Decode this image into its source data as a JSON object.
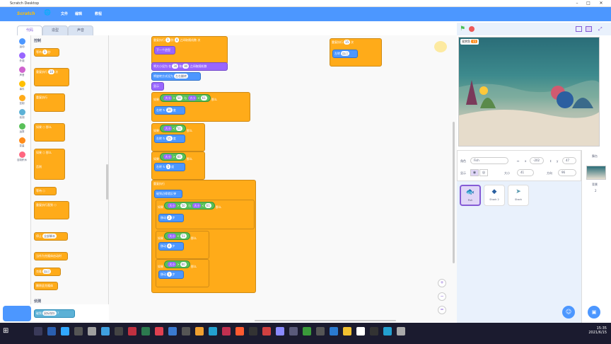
{
  "window": {
    "title": "Scratch Desktop"
  },
  "menubar": {
    "logo": "Scratch",
    "file": "文件",
    "edit": "编辑",
    "tutorials": "教程"
  },
  "tabs": {
    "code": "代码",
    "costumes": "造型",
    "sounds": "声音"
  },
  "categories": [
    {
      "label": "运动",
      "color": "#4c97ff"
    },
    {
      "label": "外观",
      "color": "#9966ff"
    },
    {
      "label": "声音",
      "color": "#cf63cf"
    },
    {
      "label": "事件",
      "color": "#ffbf00"
    },
    {
      "label": "控制",
      "color": "#ffab19"
    },
    {
      "label": "侦测",
      "color": "#5cb1d6"
    },
    {
      "label": "运算",
      "color": "#59c059"
    },
    {
      "label": "变量",
      "color": "#ff8c1a"
    },
    {
      "label": "自制积木",
      "color": "#ff6680"
    }
  ],
  "palette": {
    "section": "控制",
    "wait": "等待",
    "wait_val": "1",
    "wait_unit": "秒",
    "repeat": "重复执行",
    "repeat_val": "10",
    "repeat_unit": "次",
    "forever": "重复执行",
    "if": "如果",
    "then": "那么",
    "else": "否则",
    "wait_until": "等待",
    "repeat_until": "重复执行直到",
    "stop": "停止",
    "stop_opt": "全部脚本",
    "start_clone": "当作为克隆体启动时",
    "create_clone": "克隆",
    "clone_opt": "自己",
    "delete_clone": "删除此克隆体",
    "sensing": "侦测",
    "touching": "碰到",
    "touching_opt": "鼠标指针",
    "q": "?"
  },
  "scripts": {
    "a_repeat": "重复执行",
    "a_num1": "1",
    "a_to": "到",
    "a_num2": "4",
    "a_between": "之间取随机数",
    "a_times": "次",
    "a_next": "下一个造型",
    "a_size": "将大小设为",
    "a_rand": "在",
    "a_s1": "30",
    "a_and": "和",
    "a_s2": "80",
    "a_rand2": "之间取随机数",
    "a_rot": "将旋转方式设为",
    "a_rot_opt": "左右翻转",
    "a_show": "显示",
    "if": "如果",
    "then": "那么",
    "gt": ">",
    "lt": "<",
    "and": "与",
    "size": "大小",
    "c1_a": "50",
    "c1_b": "61",
    "turn": "右转",
    "turn_deg": "度",
    "t1": "30",
    "c2": "51",
    "t2": "15",
    "c3": "60",
    "t3": "5",
    "b_forever": "重复执行",
    "b_bounce": "碰到边缘就反弹",
    "d1_a": "50",
    "d1_b": "61",
    "move": "移动",
    "steps": "步",
    "m1": "2",
    "d2": "51",
    "m2": "4",
    "d3": "60",
    "m3": "1",
    "c_repeat": "重复执行",
    "c_val": "15",
    "c_times": "次",
    "c_turn": "左转",
    "c_opt": "自己"
  },
  "stage": {
    "sprite_name": "观赏鱼",
    "num": "15"
  },
  "info": {
    "sprite_label": "角色",
    "sprite": "Fish",
    "x_label": "x",
    "x": "-202",
    "y_label": "y",
    "y": "47",
    "show_label": "显示",
    "size_label": "大小",
    "size": "41",
    "dir_label": "方向",
    "dir": "96"
  },
  "sprites": [
    {
      "name": "Fish"
    },
    {
      "name": "Shark 2"
    },
    {
      "name": "Shark"
    }
  ],
  "backdrop": {
    "title": "舞台",
    "label": "背景",
    "count": "2"
  },
  "taskbar": {
    "time": "15:35",
    "date": "2021/6/15"
  }
}
